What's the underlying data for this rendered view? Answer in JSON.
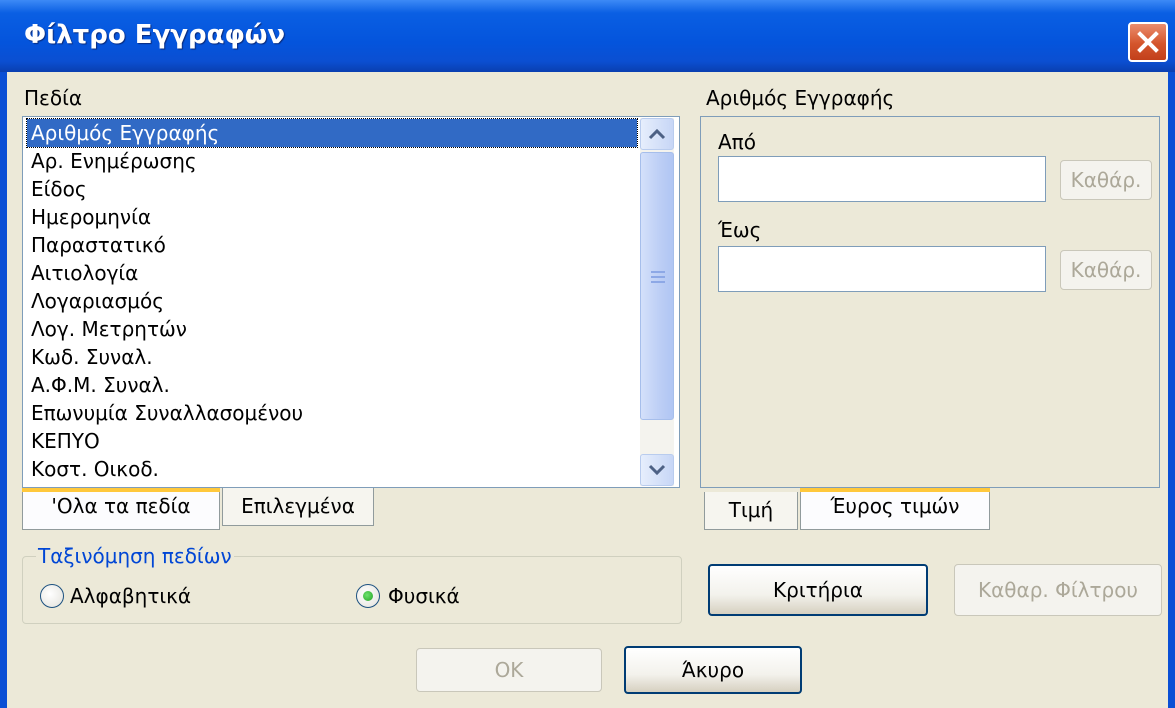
{
  "window": {
    "title": "Φίλτρο Εγγραφών"
  },
  "fields": {
    "label": "Πεδία",
    "items": [
      "Αριθμός Εγγραφής",
      "Αρ. Ενημέρωσης",
      "Είδος",
      "Ημερομηνία",
      "Παραστατικό",
      "Αιτιολογία",
      "Λογαριασμός",
      "Λογ. Μετρητών",
      "Κωδ. Συναλ.",
      "Α.Φ.Μ. Συναλ.",
      "Επωνυμία Συναλλασομένου",
      "ΚΕΠΥΟ",
      "Κοστ. Οικοδ."
    ],
    "selected_index": 0
  },
  "field_tabs": {
    "all": "'Ολα τα πεδία",
    "selected": "Επιλεγμένα"
  },
  "range": {
    "header": "Αριθμός Εγγραφής",
    "from_label": "Από",
    "from_value": "",
    "to_label": "Έως",
    "to_value": "",
    "clear_label": "Καθάρ."
  },
  "value_tabs": {
    "value": "Τιμή",
    "range": "Έυρος τιμών"
  },
  "sorting": {
    "title": "Ταξινόμηση πεδίων",
    "alphabetical": "Αλφαβητικά",
    "natural": "Φυσικά",
    "selected": "natural"
  },
  "buttons": {
    "criteria": "Κριτήρια",
    "clear_filter": "Καθαρ. Φίλτρου",
    "ok": "OK",
    "cancel": "Άκυρο"
  }
}
